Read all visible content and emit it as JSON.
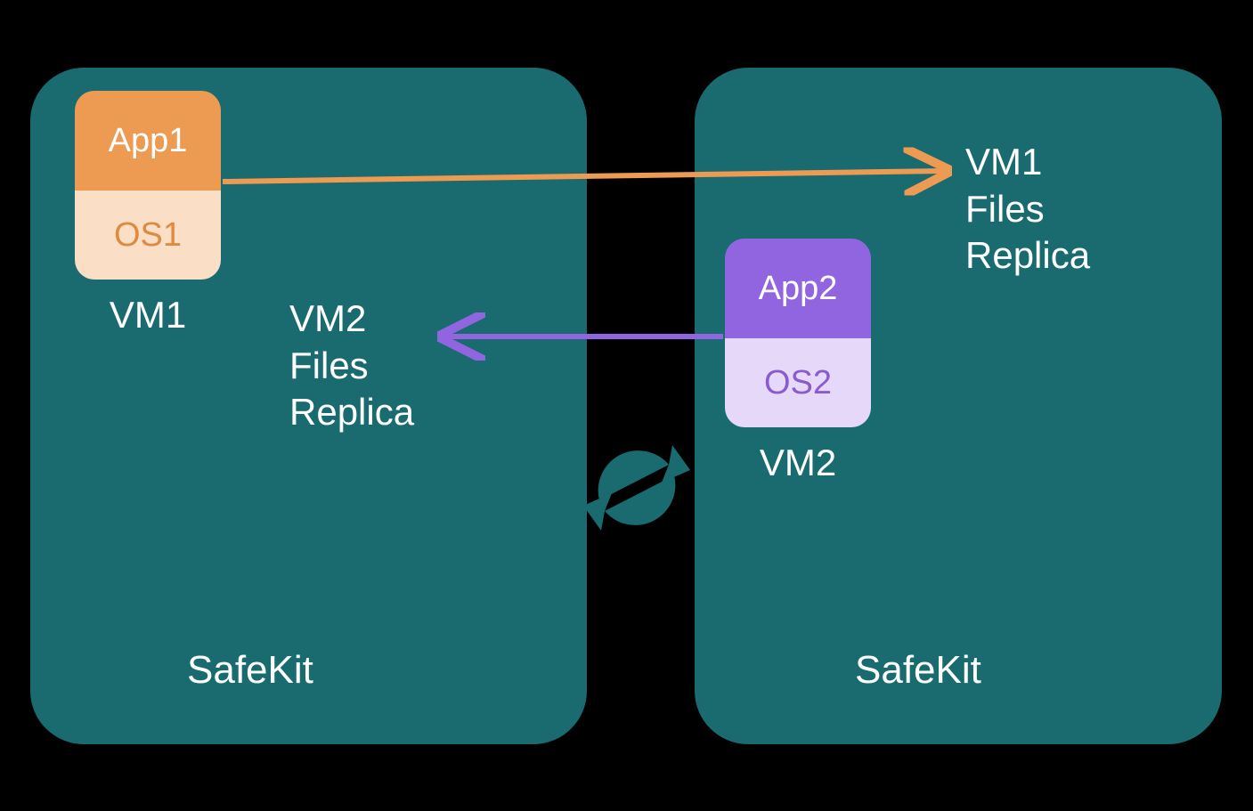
{
  "left": {
    "app": "App1",
    "os": "OS1",
    "vm": "VM1",
    "replica": "VM2\nFiles\nReplica",
    "title": "SafeKit"
  },
  "right": {
    "app": "App2",
    "os": "OS2",
    "vm": "VM2",
    "replica": "VM1\nFiles\nReplica",
    "title": "SafeKit"
  },
  "colors": {
    "panel": "#196b70",
    "orange": "#ed9a52",
    "orangeLight": "#fadfc6",
    "purple": "#9265e0",
    "purpleLight": "#e6d8f8"
  }
}
